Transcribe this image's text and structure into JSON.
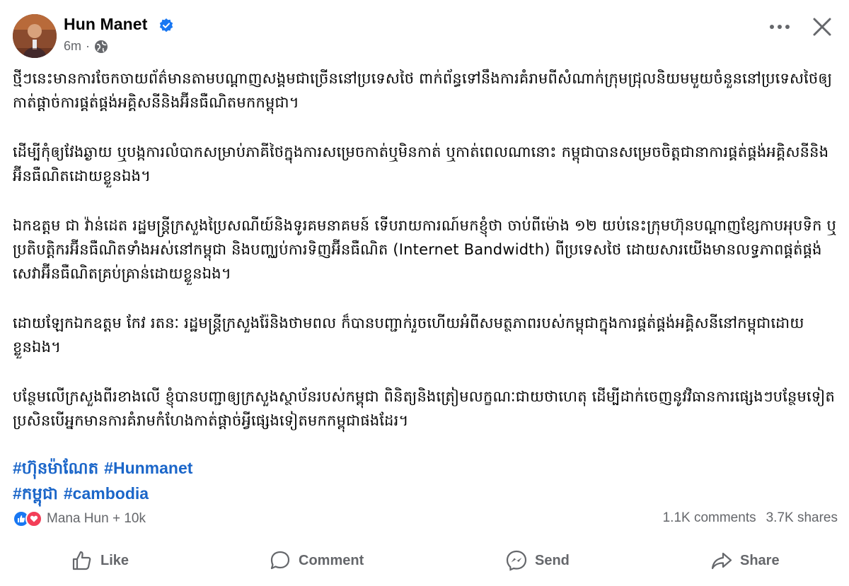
{
  "post": {
    "author": "Hun Manet",
    "time": "6m",
    "separator": "·",
    "paragraphs": [
      "ថ្មីៗនេះមានការចែកចាយព័ត៌មានតាមបណ្តាញសង្គមជាច្រើននៅប្រទេសថៃ ពាក់ព័ន្ធទៅនឹងការគំរាមពីសំណាក់ក្រុមជ្រុលនិយមមួយចំនួននៅប្រទេសថៃឲ្យកាត់ផ្តាច់ការផ្គត់ផ្គង់អគ្គិសនីនិងអ៊ីនធឺណិតមកកម្ពុជា។",
      "ដើម្បីកុំឲ្យវែងឆ្ងាយ ឬបង្កការលំបាកសម្រាប់ភាគីថៃក្នុងការសម្រេចកាត់ឬមិនកាត់ ឬកាត់ពេលណានោះ កម្ពុជាបានសម្រេចចិត្តជានាការផ្គត់ផ្គង់អគ្គិសនីនិងអ៊ីនធឺណិតដោយខ្លួនឯង។",
      "ឯកឧត្តម ជា វ៉ាន់ដេត រដ្ឋមន្ត្រីក្រសួងប្រៃសណីយ៍និងទូរគមនាគមន៍ ទើបរាយការណ៍មកខ្ញុំថា ចាប់ពីម៉ោង ១២ យប់នេះក្រុមហ៊ុនបណ្តាញខ្សែកាបអុបទិក ឬប្រតិបត្តិករអ៊ីនធឺណិតទាំងអស់នៅកម្ពុជា និងបញ្ឈប់ការទិញអ៊ីនធឺណិត (Internet Bandwidth) ពីប្រទេសថៃ ដោយសារយើងមានលទ្ធភាពផ្គត់ផ្គង់សេវាអ៊ីនធឺណិតគ្រប់គ្រាន់ដោយខ្លួនឯង។",
      "ដោយឡែកឯកឧត្តម កែវ រតនៈ រដ្ឋមន្ត្រីក្រសួងរ៉ែនិងថាមពល ក៏បានបញ្ជាក់រួចហើយអំពីសមត្ថភាពរបស់កម្ពុជាក្នុងការផ្គត់ផ្គង់អគ្គិសនីនៅកម្ពុជាដោយខ្លួនឯង។",
      "បន្ថែមលើក្រសួងពីរខាងលើ ខ្ញុំបានបញ្ជាឲ្យក្រសួងស្ថាប័នរបស់កម្ពុជា ពិនិត្យនិងត្រៀមលក្ខណៈជាយថាហេតុ ដើម្បីដាក់ចេញនូវវិធានការផ្សេងៗបន្ថែមទៀត ប្រសិនបើអ្នកមានការគំរាមកំហែងកាត់ផ្តាច់អ្វីផ្សេងទៀតមកកម្ពុជាផងដែរ។"
    ],
    "hashtags": [
      [
        "#ហ៊ុនម៉ាណែត",
        "#Hunmanet"
      ],
      [
        "#កម្ពុជា",
        "#cambodia"
      ]
    ]
  },
  "stats": {
    "reactors": "Mana Hun + 10k",
    "comments": "1.1K comments",
    "shares": "3.7K shares"
  },
  "actions": {
    "like": "Like",
    "comment": "Comment",
    "send": "Send",
    "share": "Share"
  },
  "icons": {
    "verified": "verified-badge-icon",
    "globe": "globe-icon",
    "more": "more-options-icon",
    "close": "close-icon",
    "like_reaction": "thumbs-up-icon",
    "love_reaction": "heart-icon"
  },
  "colors": {
    "hashtag": "#1b66c9",
    "verified": "#1877f2",
    "like_reaction": "#1877f2",
    "love_reaction": "#f33e58",
    "secondary_text": "#65676b"
  }
}
